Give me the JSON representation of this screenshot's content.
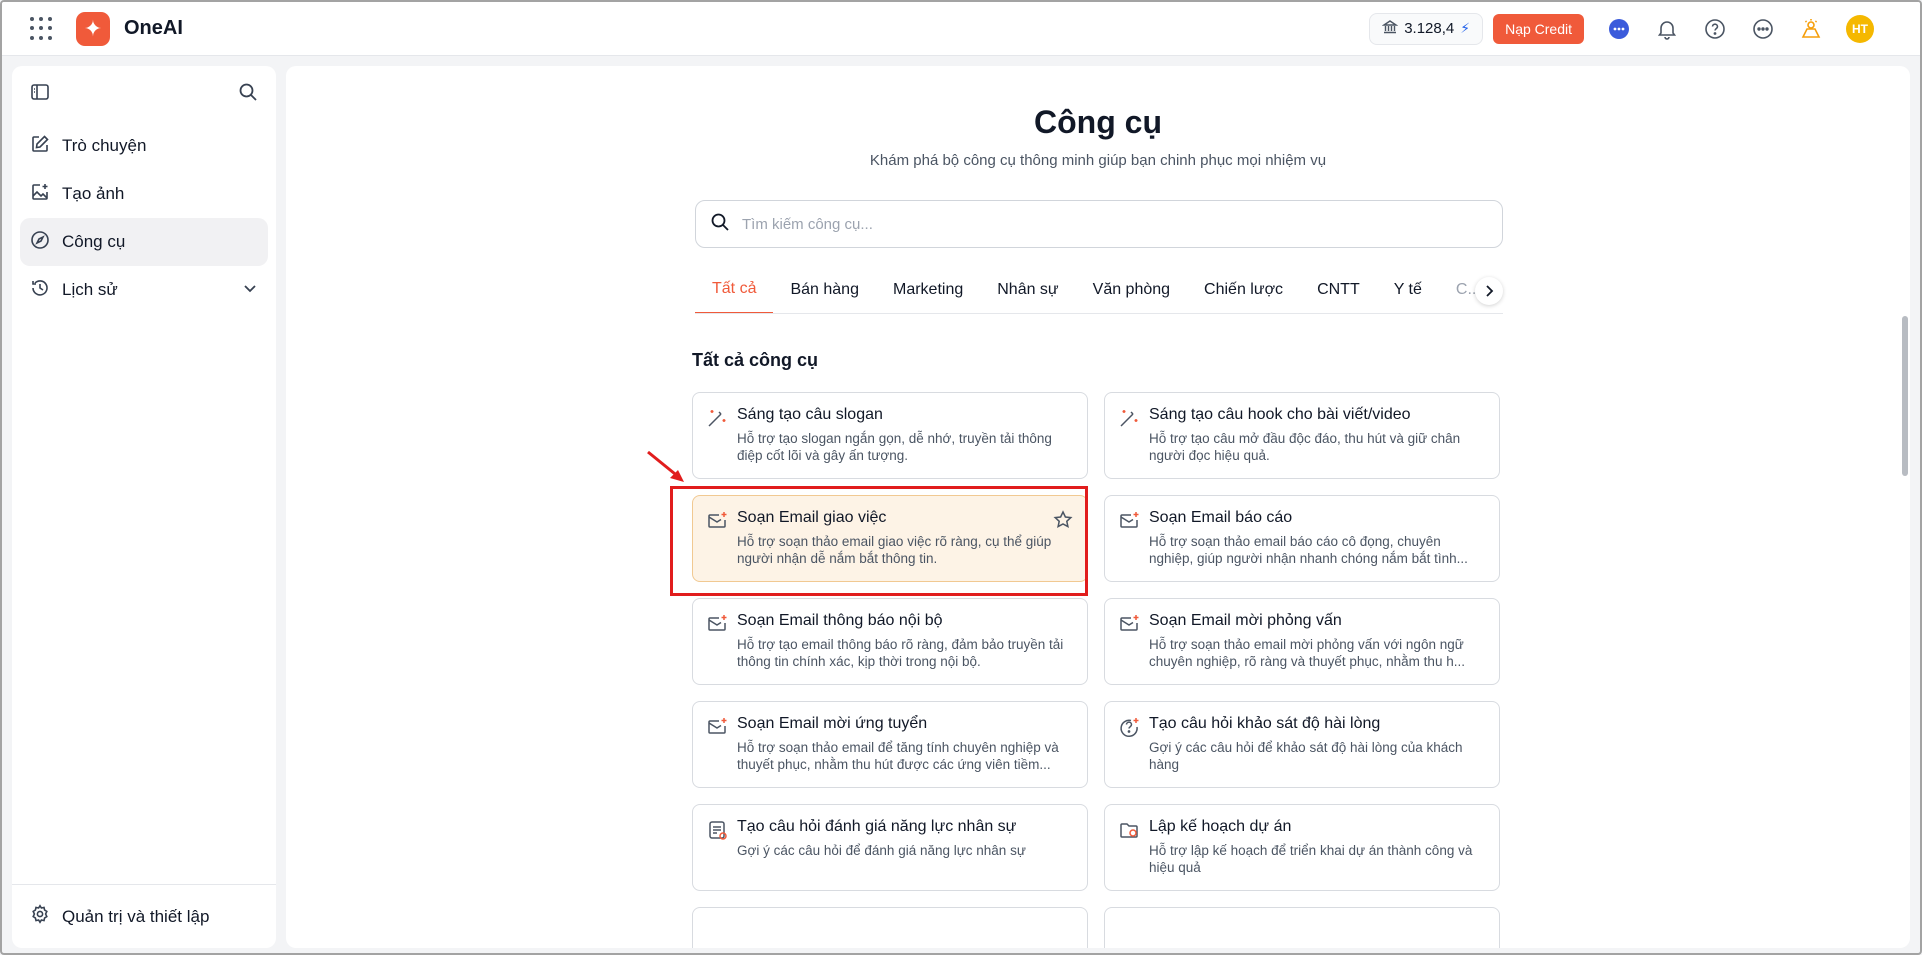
{
  "app": {
    "brand": "OneAI",
    "credit_amount": "3.128,4",
    "topup_label": "Nạp Credit",
    "avatar_initials": "HT",
    "accent_color": "#f05a3a"
  },
  "sidebar": {
    "items": [
      {
        "label": "Trò chuyện",
        "icon": "edit-square-icon"
      },
      {
        "label": "Tạo ảnh",
        "icon": "image-plus-icon"
      },
      {
        "label": "Công cụ",
        "icon": "compass-icon"
      },
      {
        "label": "Lịch sử",
        "icon": "history-icon"
      }
    ],
    "settings_label": "Quản trị và thiết lập"
  },
  "main": {
    "title": "Công cụ",
    "subtitle": "Khám phá bộ công cụ thông minh giúp bạn chinh phục mọi nhiệm vụ",
    "search_placeholder": "Tìm kiếm công cụ...",
    "tabs": [
      "Tất cả",
      "Bán hàng",
      "Marketing",
      "Nhân sự",
      "Văn phòng",
      "Chiến lược",
      "CNTT",
      "Y tế",
      "C..."
    ],
    "section_title": "Tất cả công cụ",
    "tools": [
      {
        "title": "Sáng tạo câu slogan",
        "desc": "Hỗ trợ tạo slogan ngắn gọn, dễ nhớ, truyền tải thông điệp cốt lõi và gây ấn tượng.",
        "icon": "magic-wand-icon"
      },
      {
        "title": "Sáng tạo câu hook cho bài viết/video",
        "desc": "Hỗ trợ tạo câu mở đầu độc đáo, thu hút và giữ chân người đọc hiệu quả.",
        "icon": "magic-wand-icon"
      },
      {
        "title": "Soạn Email giao việc",
        "desc": "Hỗ trợ soạn thảo email giao việc rõ ràng, cụ thể giúp người nhận dễ nắm bắt thông tin.",
        "icon": "mail-sparkle-icon"
      },
      {
        "title": "Soạn Email báo cáo",
        "desc": "Hỗ trợ soạn thảo email báo cáo cô đọng, chuyên nghiệp, giúp người nhận nhanh chóng nắm bắt tình...",
        "icon": "mail-sparkle-icon"
      },
      {
        "title": "Soạn Email thông báo nội bộ",
        "desc": "Hỗ trợ tạo email thông báo rõ ràng, đảm bảo truyền tải thông tin chính xác, kịp thời trong nội bộ.",
        "icon": "mail-sparkle-icon"
      },
      {
        "title": "Soạn Email mời phỏng vấn",
        "desc": "Hỗ trợ soạn thảo email mời phỏng vấn với ngôn ngữ chuyên nghiệp, rõ ràng và thuyết phục, nhằm thu h...",
        "icon": "mail-sparkle-icon"
      },
      {
        "title": "Soạn Email mời ứng tuyển",
        "desc": "Hỗ trợ soạn thảo email để tăng tính chuyên nghiệp và thuyết phục, nhằm thu hút được các ứng viên tiềm...",
        "icon": "mail-sparkle-icon"
      },
      {
        "title": "Tạo câu hỏi khảo sát độ hài lòng",
        "desc": "Gợi ý các câu hỏi để khảo sát độ hài lòng của khách hàng",
        "icon": "question-sparkle-icon"
      },
      {
        "title": "Tạo câu hỏi đánh giá năng lực nhân sự",
        "desc": "Gợi ý các câu hỏi để đánh giá năng lực nhân sự",
        "icon": "checklist-icon"
      },
      {
        "title": "Lập kế hoạch dự án",
        "desc": "Hỗ trợ lập kế hoạch để triển khai dự án thành công và hiệu quả",
        "icon": "folder-plan-icon"
      }
    ]
  }
}
